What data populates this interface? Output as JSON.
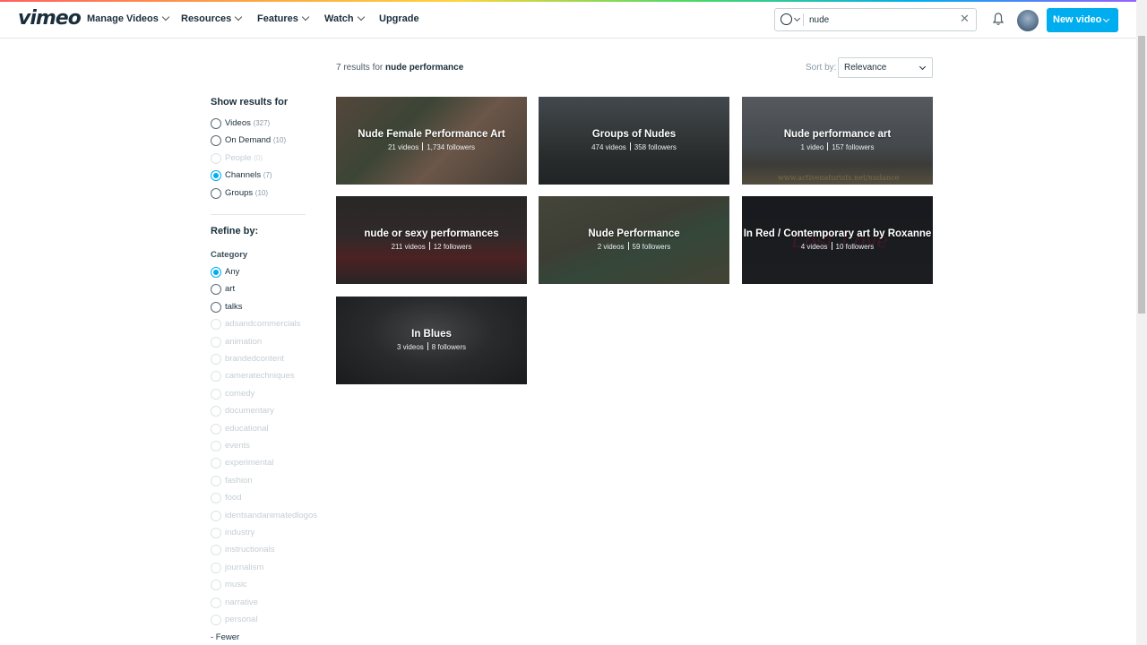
{
  "app": {
    "logo": "vimeo"
  },
  "nav": [
    {
      "label": "Manage Videos",
      "dropdown": true
    },
    {
      "label": "Resources",
      "dropdown": true
    },
    {
      "label": "Features",
      "dropdown": true
    },
    {
      "label": "Watch",
      "dropdown": true
    },
    {
      "label": "Upgrade",
      "dropdown": false
    }
  ],
  "search": {
    "value": "nude",
    "scope_icon": "globe-icon",
    "clear_icon": "close-icon"
  },
  "header": {
    "bell_icon": "bell-icon",
    "new_video_label": "New video",
    "accent": "#00adef"
  },
  "results": {
    "prefix": "7 results for",
    "query": "nude performance",
    "sort_label": "Sort by:",
    "sort_value": "Relevance"
  },
  "sidebar": {
    "show_heading": "Show results for",
    "types": [
      {
        "label": "Videos",
        "count": "(327)",
        "state": "normal"
      },
      {
        "label": "On Demand",
        "count": "(10)",
        "state": "normal"
      },
      {
        "label": "People",
        "count": "(0)",
        "state": "disabled"
      },
      {
        "label": "Channels",
        "count": "(7)",
        "state": "checked"
      },
      {
        "label": "Groups",
        "count": "(10)",
        "state": "normal"
      }
    ],
    "refine_heading": "Refine by:",
    "category_heading": "Category",
    "categories": [
      {
        "label": "Any",
        "state": "checked"
      },
      {
        "label": "art",
        "state": "normal"
      },
      {
        "label": "talks",
        "state": "normal"
      },
      {
        "label": "adsandcommercials",
        "state": "disabled"
      },
      {
        "label": "animation",
        "state": "disabled"
      },
      {
        "label": "brandedcontent",
        "state": "disabled"
      },
      {
        "label": "cameratechniques",
        "state": "disabled"
      },
      {
        "label": "comedy",
        "state": "disabled"
      },
      {
        "label": "documentary",
        "state": "disabled"
      },
      {
        "label": "educational",
        "state": "disabled"
      },
      {
        "label": "events",
        "state": "disabled"
      },
      {
        "label": "experimental",
        "state": "disabled"
      },
      {
        "label": "fashion",
        "state": "disabled"
      },
      {
        "label": "food",
        "state": "disabled"
      },
      {
        "label": "identsandanimatedlogos",
        "state": "disabled"
      },
      {
        "label": "industry",
        "state": "disabled"
      },
      {
        "label": "instructionals",
        "state": "disabled"
      },
      {
        "label": "journalism",
        "state": "disabled"
      },
      {
        "label": "music",
        "state": "disabled"
      },
      {
        "label": "narrative",
        "state": "disabled"
      },
      {
        "label": "personal",
        "state": "disabled"
      }
    ],
    "fewer_label": "- Fewer"
  },
  "channels": [
    {
      "title": "Nude Female Performance Art",
      "videos": "21 videos",
      "followers": "1,734 followers",
      "bg": "linear-gradient(135deg,#8a6d55 0%,#5c6a4a 35%,#b48a6e 60%,#6b5a48 100%)"
    },
    {
      "title": "Groups of Nudes",
      "videos": "474 videos",
      "followers": "358 followers",
      "bg": "linear-gradient(180deg,#6a7078 0%,#4a4f4c 45%,#3a3c38 70%,#2c2e2c 100%)"
    },
    {
      "title": "Nude performance art",
      "videos": "1 video",
      "followers": "157 followers",
      "bg": "linear-gradient(180deg,#8c9094 0%,#6d7276 55%,#5d5a50 78%,#8a7a5a 100%)",
      "watermark": "www.activenaturists.net/nudance"
    },
    {
      "title": "nude or sexy performances",
      "videos": "211 videos",
      "followers": "12 followers",
      "bg": "linear-gradient(180deg,#3a3230 0%,#4a3834 45%,#7a2a28 70%,#3b302d 100%)"
    },
    {
      "title": "Nude Performance",
      "videos": "2 videos",
      "followers": "59 followers",
      "bg": "linear-gradient(160deg,#6e6b52 0%,#5e5d48 40%,#4f6e52 60%,#6a6548 100%)"
    },
    {
      "title": "In Red / Contemporary art by Roxanne",
      "videos": "4 videos",
      "followers": "10 followers",
      "bg": "linear-gradient(180deg,#1c1c20 0%,#222226 100%)",
      "script": "Lost Love"
    },
    {
      "title": "In Blues",
      "videos": "3 videos",
      "followers": "8 followers",
      "bg": "radial-gradient(ellipse at 50% 40%,#6a6a6a 0%,#3a3a3a 45%,#1e1e1e 100%)"
    }
  ]
}
